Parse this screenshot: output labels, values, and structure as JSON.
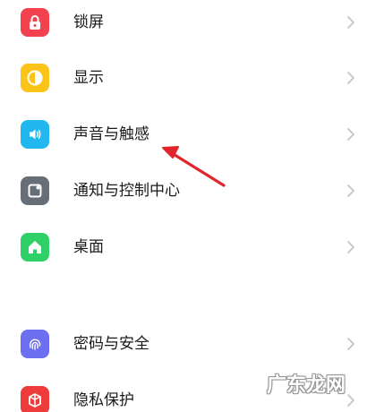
{
  "settings": {
    "items": [
      {
        "label": "锁屏",
        "icon": "lock-icon",
        "color": "#f2414f"
      },
      {
        "label": "显示",
        "icon": "display-icon",
        "color": "#fcc419"
      },
      {
        "label": "声音与触感",
        "icon": "speaker-icon",
        "color": "#22b8ef"
      },
      {
        "label": "通知与控制中心",
        "icon": "notification-icon",
        "color": "#666e78"
      },
      {
        "label": "桌面",
        "icon": "home-icon",
        "color": "#2fd166"
      },
      {
        "label": "密码与安全",
        "icon": "fingerprint-icon",
        "color": "#6b6ff0"
      },
      {
        "label": "隐私保护",
        "icon": "privacy-icon",
        "color": "#ee3c3c"
      }
    ]
  },
  "annotation": {
    "arrow_color": "#e0262a",
    "points_to": "声音与触感"
  },
  "watermark": {
    "text": "广东龙网"
  }
}
